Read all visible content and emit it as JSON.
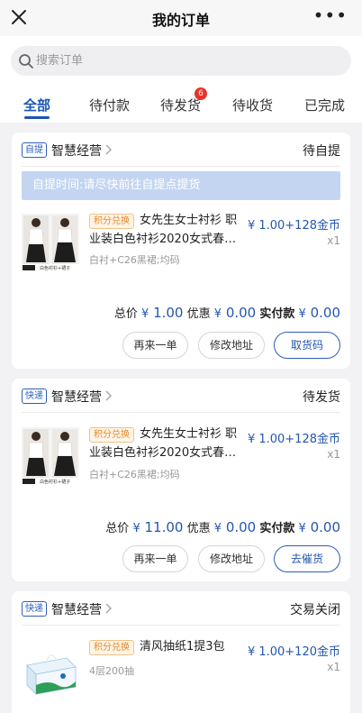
{
  "header": {
    "title": "我的订单",
    "more": "•••"
  },
  "search": {
    "placeholder": "搜索订单"
  },
  "tabs": [
    {
      "label": "全部"
    },
    {
      "label": "待付款"
    },
    {
      "label": "待发货",
      "badge": "6"
    },
    {
      "label": "待收货"
    },
    {
      "label": "已完成"
    }
  ],
  "orders": [
    {
      "tag": "自提",
      "store": "智慧经营",
      "status": "待自提",
      "notice": "自提时间:请尽快前往自提点提货",
      "item": {
        "exchange_tag": "积分兑换",
        "name": "女先生女士衬衫 职业装白色衬衫2020女式春…",
        "spec": "白衬+C26黑裙;均码",
        "price": "¥ 1.00+128金币",
        "qty": "x1",
        "thumb_caption": "白色衬衫+裙子"
      },
      "totals": {
        "total_label": "总价",
        "total_value": "1.00",
        "discount_label": "优惠",
        "discount_value": "0.00",
        "paid_label": "实付款",
        "paid_value": "0.00",
        "currency": "¥"
      },
      "buttons": {
        "rebuy": "再来一单",
        "edit_address": "修改地址",
        "primary": "取货码"
      }
    },
    {
      "tag": "快递",
      "store": "智慧经营",
      "status": "待发货",
      "item": {
        "exchange_tag": "积分兑换",
        "name": "女先生女士衬衫 职业装白色衬衫2020女式春…",
        "spec": "白衬+C26黑裙;均码",
        "price": "¥ 1.00+128金币",
        "qty": "x1",
        "thumb_caption": "白色衬衫+裙子"
      },
      "totals": {
        "total_label": "总价",
        "total_value": "11.00",
        "discount_label": "优惠",
        "discount_value": "0.00",
        "paid_label": "实付款",
        "paid_value": "0.00",
        "currency": "¥"
      },
      "buttons": {
        "rebuy": "再来一单",
        "edit_address": "修改地址",
        "primary": "去催货"
      }
    },
    {
      "tag": "快递",
      "store": "智慧经营",
      "status": "交易关闭",
      "item": {
        "exchange_tag": "积分兑换",
        "name": "清风抽纸1提3包",
        "spec": "4层200抽",
        "price": "¥ 1.00+120金币",
        "qty": "x1"
      }
    }
  ],
  "colors": {
    "accent": "#1a55b3",
    "badge": "#e8332a",
    "exchange": "#e58a2c",
    "notice_bg": "#c3d5f1"
  }
}
